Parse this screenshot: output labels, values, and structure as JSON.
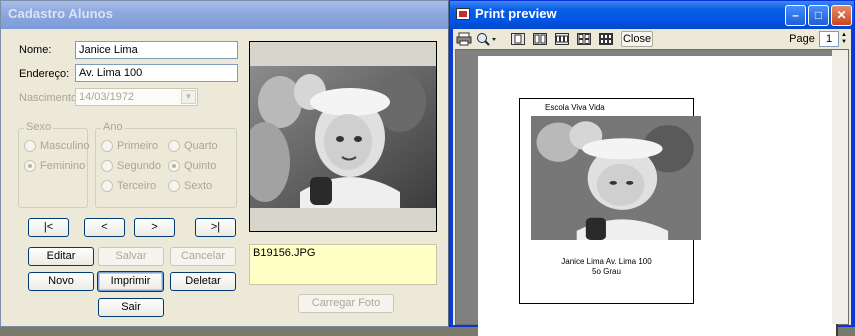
{
  "left_window": {
    "title": "Cadastro Alunos",
    "fields": {
      "nome_label": "Nome:",
      "nome_value": "Janice Lima",
      "endereco_label": "Endereço:",
      "endereco_value": "Av. Lima 100",
      "nascimento_label": "Nascimento:",
      "nascimento_value": "14/03/1972"
    },
    "sexo_group": {
      "title": "Sexo",
      "options": [
        "Masculino",
        "Feminino"
      ],
      "selected": "Feminino"
    },
    "ano_group": {
      "title": "Ano",
      "options": [
        "Primeiro",
        "Segundo",
        "Terceiro",
        "Quarto",
        "Quinto",
        "Sexto"
      ],
      "selected": "Quinto"
    },
    "nav": {
      "first": "|<",
      "prev": "<",
      "next": ">",
      "last": ">|"
    },
    "buttons": {
      "editar": "Editar",
      "salvar": "Salvar",
      "cancelar": "Cancelar",
      "novo": "Novo",
      "imprimir": "Imprimir",
      "deletar": "Deletar",
      "sair": "Sair",
      "carregar_foto": "Carregar Foto"
    },
    "photo_filename": "B19156.JPG"
  },
  "right_window": {
    "title": "Print preview",
    "toolbar": {
      "close_label": "Close",
      "page_label": "Page",
      "page_value": "1",
      "icons": [
        "printer-icon",
        "zoom-icon",
        "one-page-icon",
        "two-pages-icon",
        "three-pages-icon",
        "four-pages-icon",
        "six-pages-icon"
      ]
    },
    "page": {
      "header": "Escola Viva Vida",
      "line1": "Janice Lima Av. Lima 100",
      "line2": "5o  Grau"
    }
  },
  "colors": {
    "accent_blue": "#0055e5",
    "memo_background": "#ffffc6",
    "window_background": "#ece9d8"
  }
}
